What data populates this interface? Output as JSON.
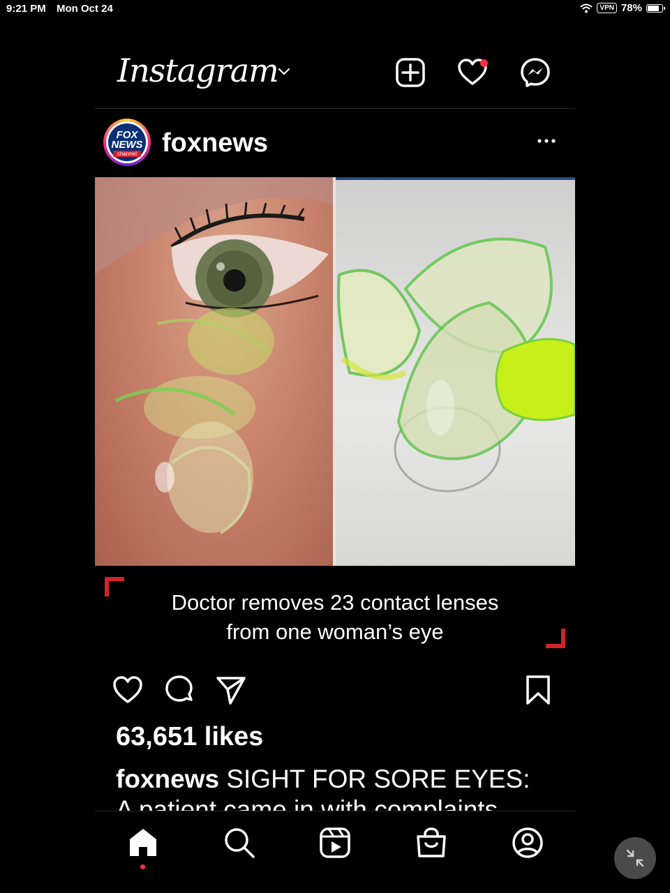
{
  "status_bar": {
    "time": "9:21 PM",
    "date": "Mon Oct 24",
    "vpn": "VPN",
    "battery": "78%",
    "battery_level": 0.78
  },
  "header": {
    "logo": "Instagram",
    "icons": [
      "new-post-icon",
      "heart-icon",
      "messenger-icon"
    ],
    "has_notification": true
  },
  "post": {
    "avatar_logo": {
      "line1": "FOX",
      "line2": "NEWS",
      "line3": "channel"
    },
    "username": "foxnews",
    "image_caption": [
      "Doctor removes 23 contact lenses",
      "from one woman’s eye"
    ],
    "likes": "63,651 likes",
    "caption_user": "foxnews",
    "caption_text": " SIGHT FOR SORE EYES:",
    "caption_text_2": "A patient came in with complaints"
  },
  "bottom_nav": [
    "home-icon",
    "search-icon",
    "reels-icon",
    "shop-icon",
    "profile-icon"
  ],
  "colors": {
    "background": "#000000",
    "accent_red": "#ff3040",
    "bracket_red": "#d2232a",
    "divider": "#262626"
  }
}
